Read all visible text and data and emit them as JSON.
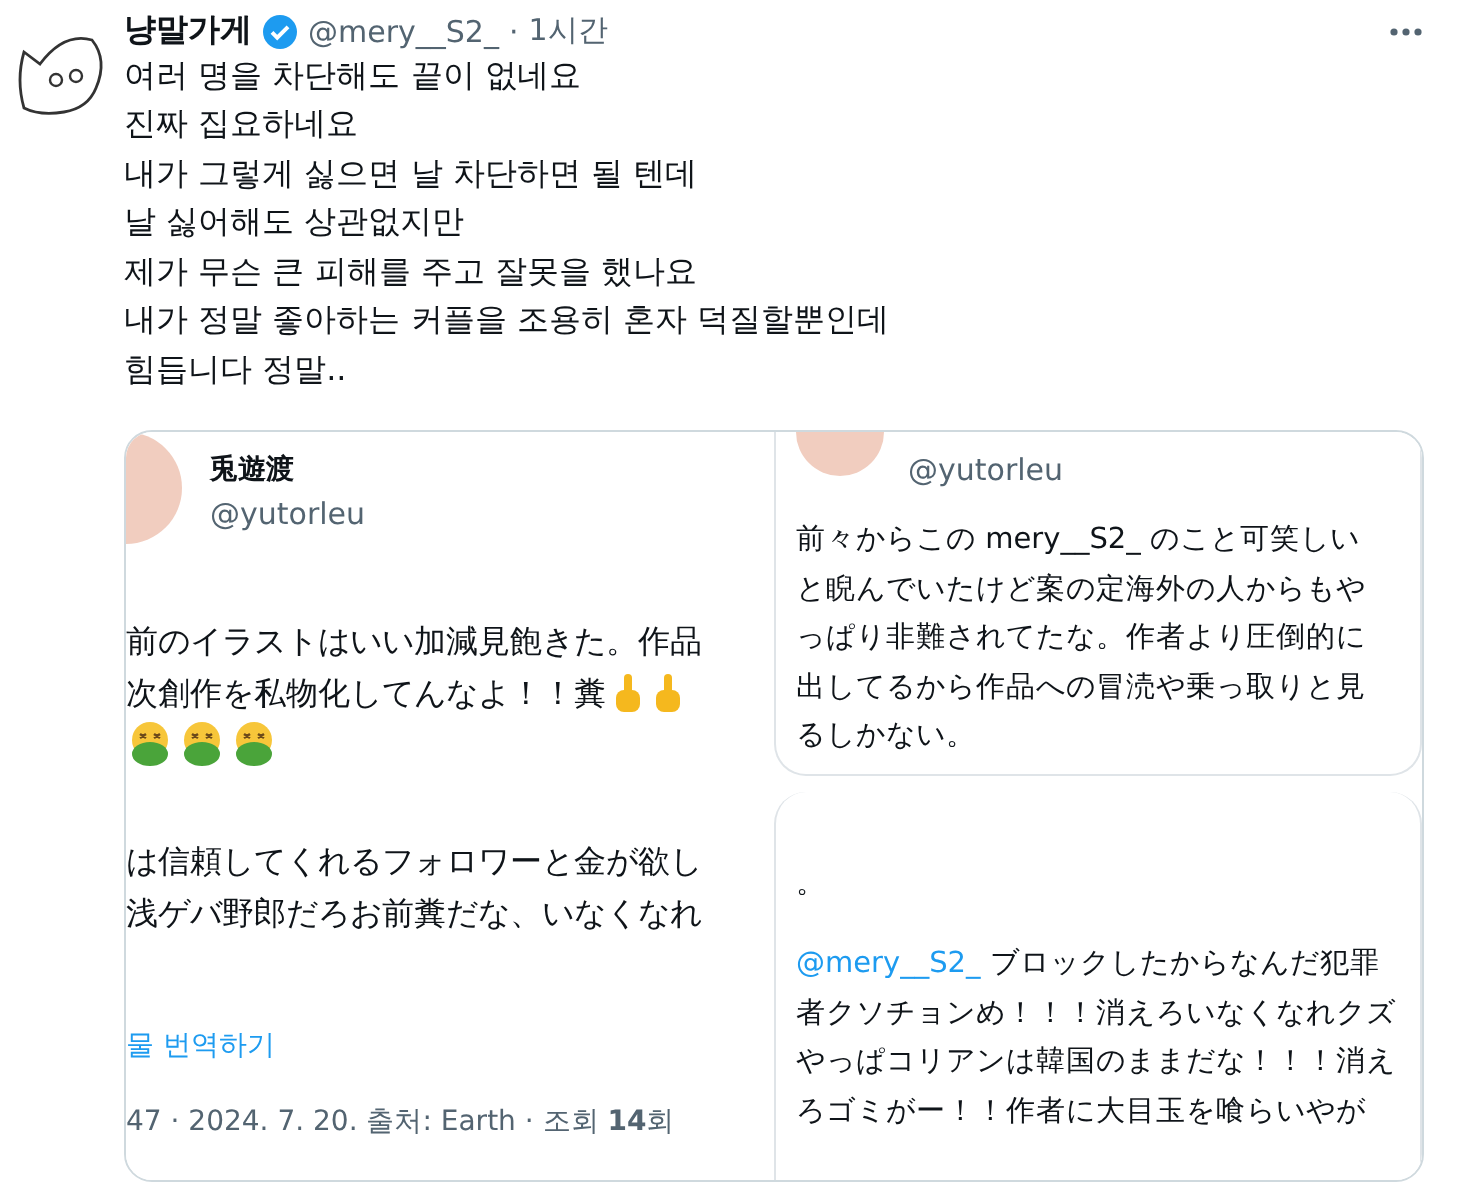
{
  "tweet": {
    "author": "냥말가게",
    "verified": true,
    "handle": "@mery__S2_",
    "separator": "·",
    "time": "1시간",
    "body_lines": [
      "여러 명을 차단해도 끝이 없네요",
      "진짜 집요하네요",
      "내가 그렇게 싫으면 날 차단하면 될 텐데",
      "날 싫어해도 상관없지만",
      "제가 무슨 큰 피해를 주고 잘못을 했나요",
      "내가 정말 좋아하는 커플을 조용히 혼자 덕질할뿐인데",
      "힘듭니다 정말.."
    ]
  },
  "media": {
    "left_screenshot": {
      "author": "兎遊渡",
      "handle": "@yutorleu",
      "paragraphs": [
        [
          [
            {
              "kind": "text",
              "text": "前のイラストはいい加減見飽きた。作品"
            }
          ],
          [
            {
              "kind": "text",
              "text": "次創作を私物化してんなよ！！糞"
            },
            {
              "kind": "finger"
            },
            {
              "kind": "finger"
            }
          ],
          [
            {
              "kind": "vomit"
            },
            {
              "kind": "vomit"
            },
            {
              "kind": "vomit"
            }
          ]
        ],
        [
          [
            {
              "kind": "text",
              "text": "は信頼してくれるフォロワーと金が欲し"
            }
          ],
          [
            {
              "kind": "text",
              "text": "浅ゲバ野郎だろお前糞だな、いなくなれ"
            }
          ]
        ]
      ],
      "translate": "물 번역하기",
      "meta": "47 · 2024. 7. 20. 출처: Earth · 조회 **14**회"
    },
    "right_screenshot": {
      "handle": "@yutorleu",
      "lines": [
        "前々からこの mery__S2_ のこと可笑しい",
        "と睨んでいたけど案の定海外の人からもや",
        "っぱり非難されてたな。作者より圧倒的に",
        "出してるから作品への冒涜や乗っ取りと見",
        "るしかない。"
      ],
      "reply_fragment": "。",
      "mention": "@mery__S2_",
      "reply_lines": [
        "ブロックしたからなんだ犯罪",
        "者クソチョンめ！！！消えろいなくなれクズ",
        "やっぱコリアンは韓国のままだな！！！消え",
        "ろゴミがー！！作者に大目玉を喰らいやが"
      ]
    }
  }
}
